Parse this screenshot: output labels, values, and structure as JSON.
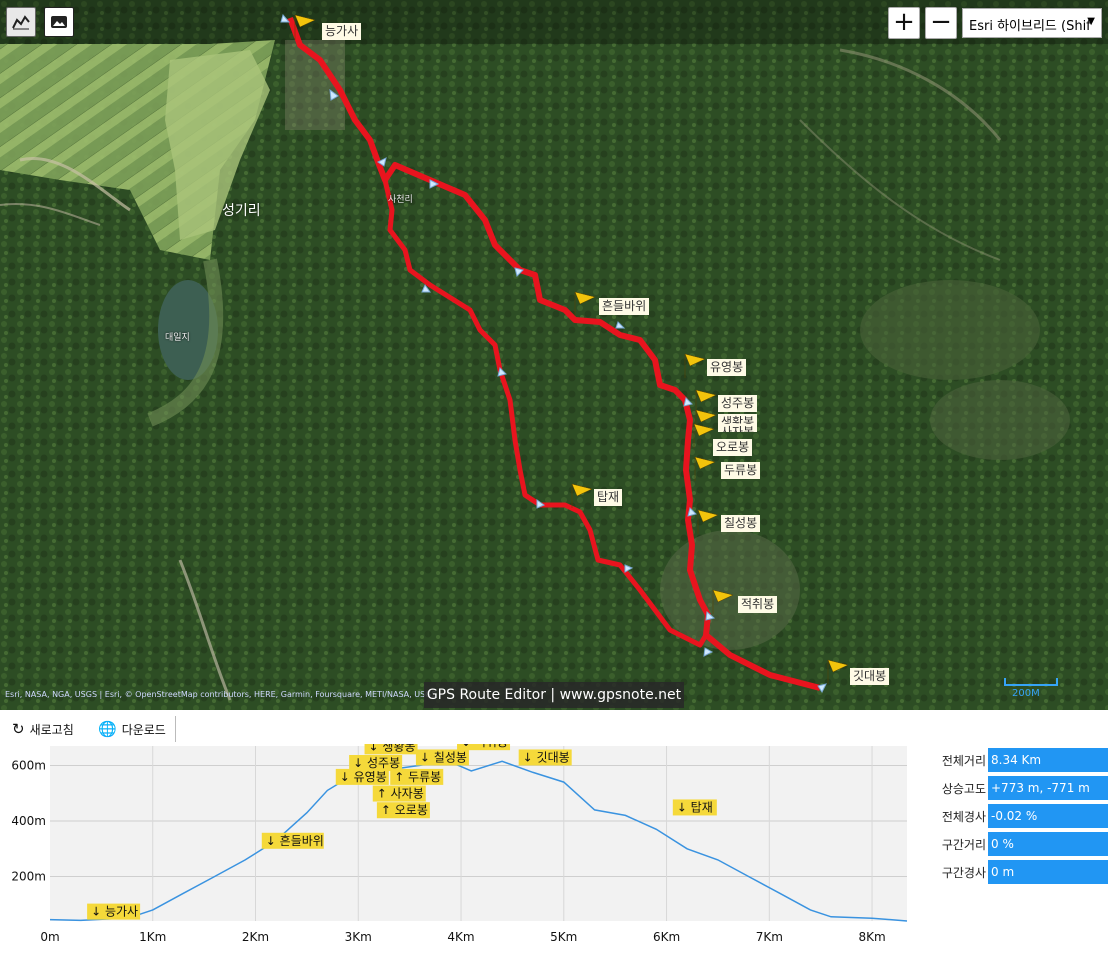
{
  "map": {
    "layer_select": "Esri 하이브리드 (Shif",
    "zoom_in": "+",
    "zoom_out": "−",
    "town_label": "성기리",
    "pond_label": "대일지",
    "village_label": "사천리",
    "attribution": "Esri, NASA, NGA, USGS | Esri, © OpenStreetMap contributors, HERE, Garmin, Foursquare, METI/NASA, USGS",
    "brand": "GPS Route Editor | www.gpsnote.net",
    "scale": "200M",
    "waypoints": [
      "능가사",
      "흔들바위",
      "유영봉",
      "성주봉",
      "생황봉",
      "사자봉",
      "오로봉",
      "두류봉",
      "칠성봉",
      "적취봉",
      "탑재",
      "깃대봉"
    ],
    "colors": {
      "route": "#e8141e",
      "flag": "#f2c40c",
      "accent": "#2196f3"
    }
  },
  "toolbar": {
    "refresh": "새로고침",
    "download": "다운로드"
  },
  "stats": [
    {
      "label": "전체거리",
      "value": "8.34 Km"
    },
    {
      "label": "상승고도",
      "value": "+773 m, -771 m"
    },
    {
      "label": "전체경사",
      "value": "-0.02 %"
    },
    {
      "label": "구간거리",
      "value": "0 %"
    },
    {
      "label": "구간경사",
      "value": "0 m"
    }
  ],
  "chart_data": {
    "type": "area",
    "xlabel": "",
    "ylabel": "",
    "xlim": [
      0,
      8.34
    ],
    "ylim": [
      40,
      670
    ],
    "x_ticks": [
      "0m",
      "1Km",
      "2Km",
      "3Km",
      "4Km",
      "5Km",
      "6Km",
      "7Km",
      "8Km"
    ],
    "y_ticks": [
      "200m",
      "400m",
      "600m"
    ],
    "x": [
      0,
      0.3,
      0.6,
      0.8,
      1.0,
      1.3,
      1.6,
      1.9,
      2.2,
      2.5,
      2.7,
      2.9,
      3.05,
      3.2,
      3.4,
      3.6,
      3.85,
      4.1,
      4.4,
      4.7,
      5.0,
      5.3,
      5.6,
      5.9,
      6.2,
      6.5,
      6.8,
      7.1,
      7.4,
      7.6,
      8.0,
      8.34
    ],
    "series": [
      {
        "values": [
          45,
          42,
          48,
          55,
          80,
          140,
          200,
          260,
          330,
          430,
          510,
          555,
          580,
          600,
          590,
          600,
          620,
          580,
          615,
          575,
          540,
          440,
          420,
          370,
          300,
          260,
          200,
          140,
          80,
          55,
          50,
          40
        ]
      }
    ],
    "annotations": [
      {
        "label": "↓ 능가사",
        "x": 0.4,
        "y": 45
      },
      {
        "label": "↓ 흔들바위",
        "x": 2.1,
        "y": 300
      },
      {
        "label": "↓ 유영봉",
        "x": 2.82,
        "y": 530
      },
      {
        "label": "↓ 성주봉",
        "x": 2.95,
        "y": 580
      },
      {
        "label": "↓ 생황봉",
        "x": 3.1,
        "y": 640
      },
      {
        "label": "↑ 사자봉",
        "x": 3.18,
        "y": 470
      },
      {
        "label": "↑ 오로봉",
        "x": 3.22,
        "y": 410
      },
      {
        "label": "↑ 두류봉",
        "x": 3.35,
        "y": 530
      },
      {
        "label": "↓ 칠성봉",
        "x": 3.6,
        "y": 600
      },
      {
        "label": "↓ 적취봉",
        "x": 4.0,
        "y": 655
      },
      {
        "label": "↓ 깃대봉",
        "x": 4.6,
        "y": 600
      },
      {
        "label": "↓ 탑재",
        "x": 6.1,
        "y": 420
      }
    ],
    "grid": true,
    "line_color": "#3a93e0"
  }
}
